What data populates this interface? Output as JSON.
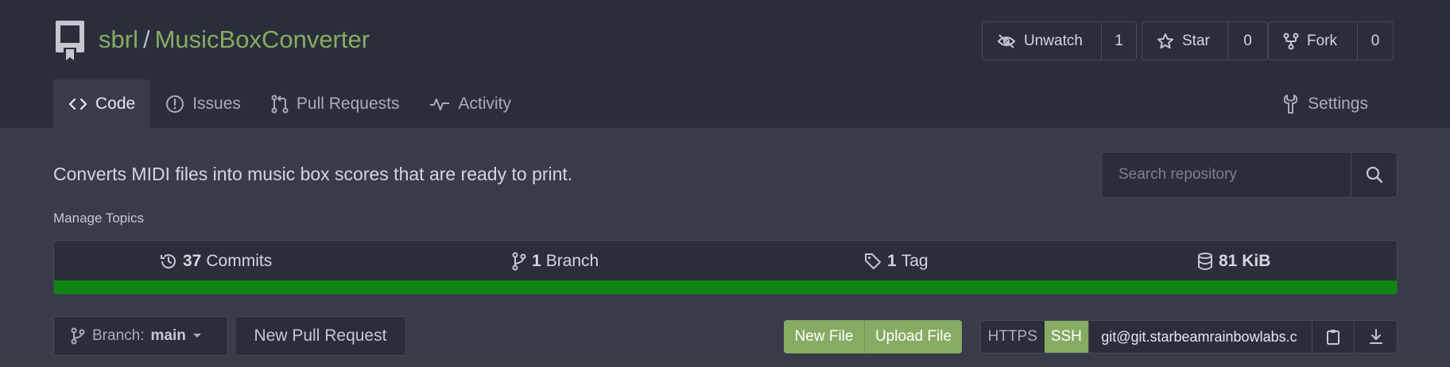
{
  "repo": {
    "owner": "sbrl",
    "separator": "/",
    "name": "MusicBoxConverter",
    "description": "Converts MIDI files into music box scores that are ready to print.",
    "manage_topics": "Manage Topics"
  },
  "actions": {
    "watch": {
      "label": "Unwatch",
      "count": "1"
    },
    "star": {
      "label": "Star",
      "count": "0"
    },
    "fork": {
      "label": "Fork",
      "count": "0"
    }
  },
  "tabs": [
    {
      "label": "Code",
      "icon": "code-icon",
      "active": true
    },
    {
      "label": "Issues",
      "icon": "issue-icon"
    },
    {
      "label": "Pull Requests",
      "icon": "pull-request-icon"
    },
    {
      "label": "Activity",
      "icon": "pulse-icon"
    }
  ],
  "settings": {
    "label": "Settings",
    "icon": "tools-icon"
  },
  "search": {
    "placeholder": "Search repository"
  },
  "stats": {
    "commits": {
      "count": "37",
      "label": "Commits"
    },
    "branches": {
      "count": "1",
      "label": "Branch"
    },
    "tags": {
      "count": "1",
      "label": "Tag"
    },
    "size": {
      "value": "81 KiB"
    }
  },
  "language_bar": {
    "color": "#0f8511",
    "fraction": 1.0
  },
  "branch": {
    "prefix": "Branch:",
    "current": "main"
  },
  "buttons": {
    "new_pull_request": "New Pull Request",
    "new_file": "New File",
    "upload_file": "Upload File"
  },
  "clone": {
    "https": "HTTPS",
    "ssh": "SSH",
    "url": "git@git.starbeamrainbowlabs.c"
  },
  "colors": {
    "accent": "#87ab63",
    "header_bg": "#2a2e3a",
    "body_bg": "#383c4a"
  }
}
